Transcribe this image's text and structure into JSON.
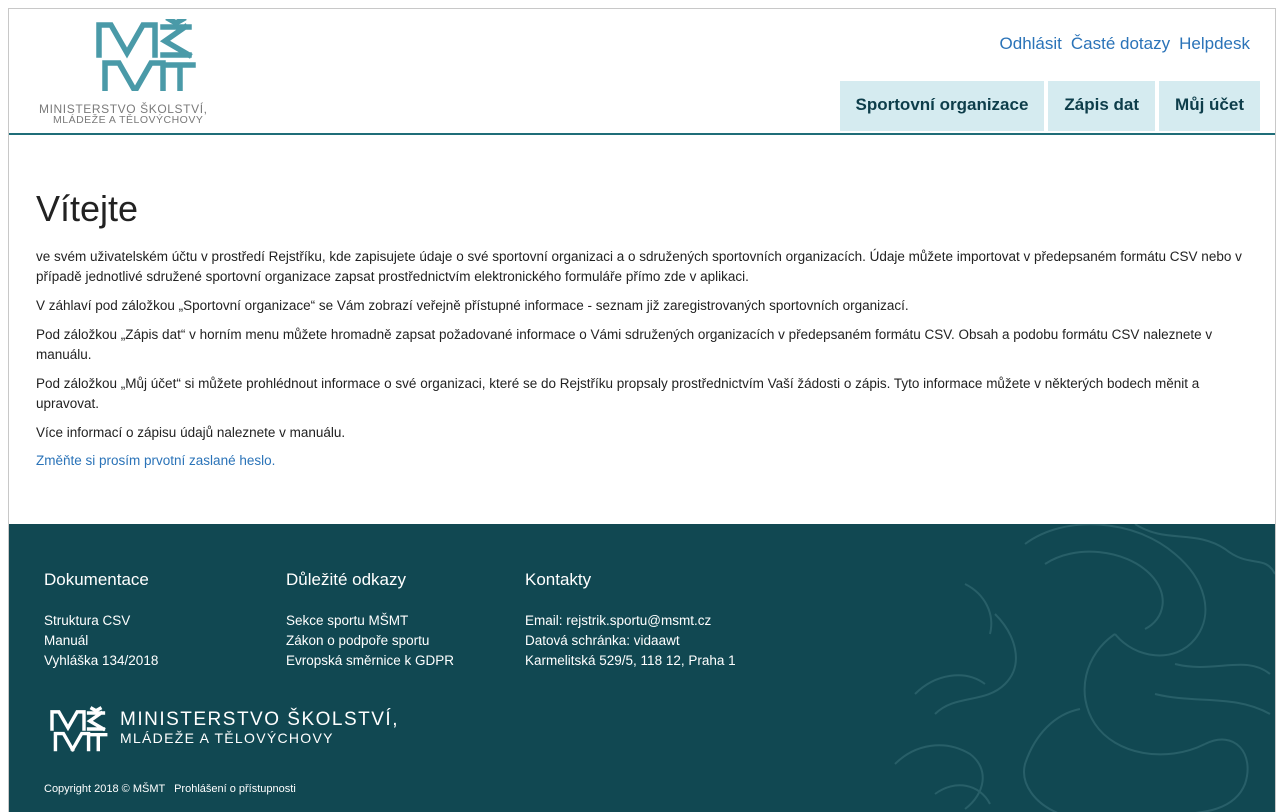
{
  "header": {
    "logo_line1": "MINISTERSTVO ŠKOLSTVÍ,",
    "logo_line2": "MLÁDEŽE A TĚLOVÝCHOVY",
    "top_links": [
      "Odhlásit",
      "Časté dotazy",
      "Helpdesk"
    ],
    "nav": [
      "Sportovní organizace",
      "Zápis dat",
      "Můj účet"
    ]
  },
  "main": {
    "title": "Vítejte",
    "paragraphs": [
      "ve svém uživatelském účtu v prostředí Rejstříku, kde zapisujete údaje o své sportovní organizaci a o sdružených sportovních organizacích. Údaje můžete importovat v předepsaném formátu CSV nebo v případě jednotlivé sdružené sportovní organizace zapsat prostřednictvím elektronického formuláře přímo zde v aplikaci.",
      "V záhlaví pod záložkou „Sportovní organizace“ se Vám zobrazí veřejně přístupné informace - seznam již zaregistrovaných sportovních organizací.",
      "Pod záložkou „Zápis dat“ v horním menu můžete hromadně zapsat požadované informace o Vámi sdružených organizacích v předepsaném formátu CSV. Obsah a podobu formátu CSV naleznete v manuálu.",
      "Pod záložkou „Můj účet“ si můžete prohlédnout informace o své organizaci, které se do Rejstříku propsaly prostřednictvím Vaší žádosti o zápis. Tyto informace můžete v některých bodech měnit a upravovat.",
      "Více informací o zápisu údajů naleznete v manuálu."
    ],
    "password_link": "Změňte si prosím prvotní zaslané heslo."
  },
  "footer": {
    "columns": [
      {
        "title": "Dokumentace",
        "items": [
          "Struktura CSV",
          "Manuál",
          "Vyhláška 134/2018"
        ]
      },
      {
        "title": "Důležité odkazy",
        "items": [
          "Sekce sportu MŠMT",
          "Zákon o podpoře sportu",
          "Evropská směrnice k GDPR"
        ]
      },
      {
        "title": "Kontakty",
        "items": [
          "Email: rejstrik.sportu@msmt.cz",
          "Datová schránka: vidaawt",
          "Karmelitská 529/5, 118 12, Praha 1"
        ]
      }
    ],
    "logo_line1": "MINISTERSTVO ŠKOLSTVÍ,",
    "logo_line2": "MLÁDEŽE A TĚLOVÝCHOVY",
    "copyright": "Copyright 2018 © MŠMT",
    "accessibility_link": "Prohlášení o přístupnosti"
  },
  "colors": {
    "accent": "#2a73b8",
    "logo": "#4a9aa8",
    "nav_bg": "#d5ebf0",
    "footer_bg": "#114852"
  }
}
